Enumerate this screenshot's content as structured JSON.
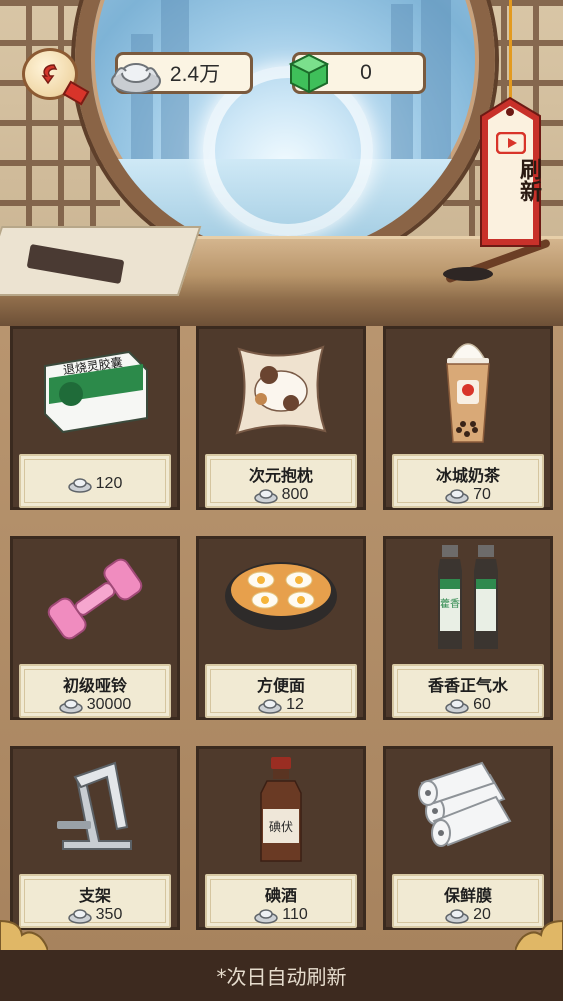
{
  "header": {
    "silver_amount": "2.4万",
    "jade_amount": "0",
    "refresh_label": "刷新"
  },
  "shop": {
    "items": [
      {
        "name": "",
        "price": "120",
        "icon": "medicine-box-icon"
      },
      {
        "name": "次元抱枕",
        "price": "800",
        "icon": "pillow-icon"
      },
      {
        "name": "冰城奶茶",
        "price": "70",
        "icon": "milk-tea-icon"
      },
      {
        "name": "初级哑铃",
        "price": "30000",
        "icon": "dumbbell-icon"
      },
      {
        "name": "方便面",
        "price": "12",
        "icon": "noodle-bowl-icon"
      },
      {
        "name": "香香正气水",
        "price": "60",
        "icon": "herbal-bottles-icon"
      },
      {
        "name": "支架",
        "price": "350",
        "icon": "phone-stand-icon"
      },
      {
        "name": "碘酒",
        "price": "110",
        "icon": "iodine-bottle-icon"
      },
      {
        "name": "保鲜膜",
        "price": "20",
        "icon": "plastic-wrap-icon"
      }
    ],
    "art_text": {
      "medicine_box": "退烧灵胶囊",
      "iodine_label": "碘伏",
      "bottle_label": "藿香"
    }
  },
  "footer": {
    "note": "*次日自动刷新"
  },
  "colors": {
    "wood_dark": "#4f3a2c",
    "label_bg": "#f1ead3",
    "refresh_red": "#c8312a"
  }
}
